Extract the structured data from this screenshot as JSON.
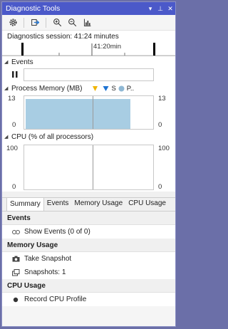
{
  "window": {
    "title": "Diagnostic Tools",
    "title_buttons": [
      "▾",
      "⊥",
      "✕"
    ]
  },
  "toolbar": {
    "icons": [
      "gear-icon",
      "export-icon",
      "zoom-in-icon",
      "zoom-out-icon",
      "reset-view-icon"
    ]
  },
  "session": {
    "text": "Diagnostics session: 41:24 minutes"
  },
  "timeline": {
    "tick_label": "41:20min"
  },
  "events_section": {
    "title": "Events"
  },
  "memory_section": {
    "title": "Process Memory (MB)",
    "legend": [
      {
        "icon": "snapshot-marker",
        "label": "",
        "color": "#f0b400"
      },
      {
        "icon": "gc-marker",
        "label": "S",
        "color": "#1e73d2"
      },
      {
        "icon": "private-bytes-dot",
        "label": "P..",
        "color": "#8fb8d4"
      }
    ],
    "y_max_left": "13",
    "y_min_left": "0",
    "y_max_right": "13",
    "y_min_right": "0",
    "fill_color": "#a8cde3"
  },
  "cpu_section": {
    "title": "CPU (% of all processors)",
    "y_max_left": "100",
    "y_min_left": "0",
    "y_max_right": "100",
    "y_min_right": "0"
  },
  "tabs": [
    {
      "label": "Summary",
      "active": true
    },
    {
      "label": "Events",
      "active": false
    },
    {
      "label": "Memory Usage",
      "active": false
    },
    {
      "label": "CPU Usage",
      "active": false
    }
  ],
  "summary": {
    "events_header": "Events",
    "show_events": "Show Events (0 of 0)",
    "memory_header": "Memory Usage",
    "take_snapshot": "Take Snapshot",
    "snapshots": "Snapshots: 1",
    "cpu_header": "CPU Usage",
    "record_cpu": "Record CPU Profile"
  }
}
